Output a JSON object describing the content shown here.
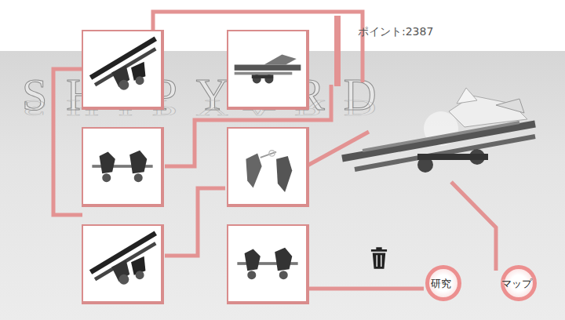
{
  "screen": {
    "title": "SHIPYARD",
    "points": "ポイント:2387"
  },
  "parts": [
    {
      "kind": "long"
    },
    {
      "kind": "cannon"
    },
    {
      "kind": "pair"
    },
    {
      "kind": "turret"
    },
    {
      "kind": "long"
    },
    {
      "kind": "pair"
    }
  ],
  "buttons": [
    {
      "label": "研究"
    },
    {
      "label": "マップ"
    }
  ]
}
